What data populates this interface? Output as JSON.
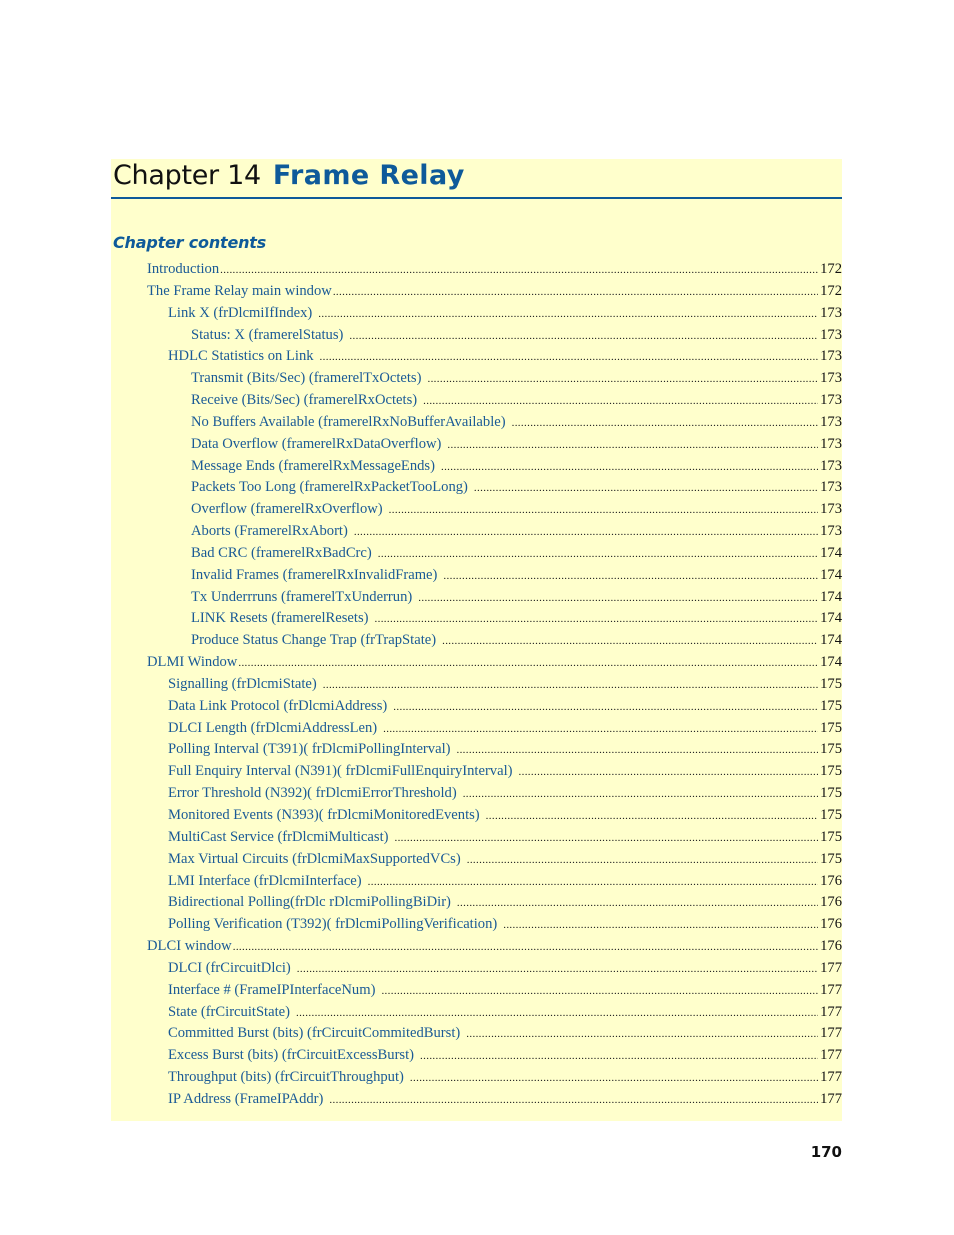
{
  "chapter": {
    "label": "Chapter 14",
    "title": "Frame Relay"
  },
  "contents_heading": "Chapter contents",
  "colors": {
    "accent": "#0e5a9a",
    "panel_background": "#ffffcc",
    "toc_text": "#1a5a96"
  },
  "toc": [
    {
      "level": 0,
      "title": "Introduction",
      "page": "172"
    },
    {
      "level": 0,
      "title": "The Frame Relay main window",
      "page": "172"
    },
    {
      "level": 1,
      "title": "Link X (frDlcmiIfIndex)",
      "page": "173"
    },
    {
      "level": 2,
      "title": "Status: X (framerelStatus)",
      "page": "173"
    },
    {
      "level": 1,
      "title": "HDLC Statistics on Link",
      "page": "173"
    },
    {
      "level": 2,
      "title": "Transmit (Bits/Sec) (framerelTxOctets)",
      "page": "173"
    },
    {
      "level": 2,
      "title": "Receive (Bits/Sec) (framerelRxOctets)",
      "page": "173"
    },
    {
      "level": 2,
      "title": "No Buffers Available (framerelRxNoBufferAvailable)",
      "page": "173"
    },
    {
      "level": 2,
      "title": "Data Overflow (framerelRxDataOverflow)",
      "page": "173"
    },
    {
      "level": 2,
      "title": "Message Ends (framerelRxMessageEnds)",
      "page": "173"
    },
    {
      "level": 2,
      "title": "Packets Too Long (framerelRxPacketTooLong)",
      "page": "173"
    },
    {
      "level": 2,
      "title": "Overflow (framerelRxOverflow)",
      "page": "173"
    },
    {
      "level": 2,
      "title": "Aborts (FramerelRxAbort)",
      "page": "173"
    },
    {
      "level": 2,
      "title": "Bad CRC (framerelRxBadCrc)",
      "page": "174"
    },
    {
      "level": 2,
      "title": "Invalid Frames (framerelRxInvalidFrame)",
      "page": "174"
    },
    {
      "level": 2,
      "title": "Tx Underrruns (framerelTxUnderrun)",
      "page": "174"
    },
    {
      "level": 2,
      "title": "LINK Resets (framerelResets)",
      "page": "174"
    },
    {
      "level": 2,
      "title": "Produce Status Change Trap (frTrapState)",
      "page": "174"
    },
    {
      "level": 0,
      "title": "DLMI Window",
      "page": "174"
    },
    {
      "level": 1,
      "title": "Signalling (frDlcmiState)",
      "page": "175"
    },
    {
      "level": 1,
      "title": "Data Link Protocol (frDlcmiAddress)",
      "page": "175"
    },
    {
      "level": 1,
      "title": "DLCI Length (frDlcmiAddressLen)",
      "page": "175"
    },
    {
      "level": 1,
      "title": "Polling Interval (T391)( frDlcmiPollingInterval)",
      "page": "175"
    },
    {
      "level": 1,
      "title": "Full Enquiry Interval (N391)( frDlcmiFullEnquiryInterval)",
      "page": "175"
    },
    {
      "level": 1,
      "title": "Error Threshold (N392)( frDlcmiErrorThreshold)",
      "page": "175"
    },
    {
      "level": 1,
      "title": "Monitored Events (N393)( frDlcmiMonitoredEvents)",
      "page": "175"
    },
    {
      "level": 1,
      "title": "MultiCast Service (frDlcmiMulticast)",
      "page": "175"
    },
    {
      "level": 1,
      "title": "Max Virtual Circuits (frDlcmiMaxSupportedVCs)",
      "page": "175"
    },
    {
      "level": 1,
      "title": "LMI Interface (frDlcmiInterface)",
      "page": "176"
    },
    {
      "level": 1,
      "title": "Bidirectional Polling(frDlc rDlcmiPollingBiDir)",
      "page": "176"
    },
    {
      "level": 1,
      "title": "Polling Verification (T392)( frDlcmiPollingVerification)",
      "page": "176"
    },
    {
      "level": 0,
      "title": "DLCI window",
      "page": "176"
    },
    {
      "level": 1,
      "title": "DLCI (frCircuitDlci)",
      "page": "177"
    },
    {
      "level": 1,
      "title": "Interface # (FrameIPInterfaceNum)",
      "page": "177"
    },
    {
      "level": 1,
      "title": "State (frCircuitState)",
      "page": "177"
    },
    {
      "level": 1,
      "title": "Committed Burst (bits) (frCircuitCommitedBurst)",
      "page": "177"
    },
    {
      "level": 1,
      "title": "Excess Burst (bits) (frCircuitExcessBurst)",
      "page": "177"
    },
    {
      "level": 1,
      "title": "Throughput (bits) (frCircuitThroughput)",
      "page": "177"
    },
    {
      "level": 1,
      "title": "IP Address (FrameIPAddr)",
      "page": "177"
    }
  ],
  "footer": {
    "page_number": "170"
  }
}
